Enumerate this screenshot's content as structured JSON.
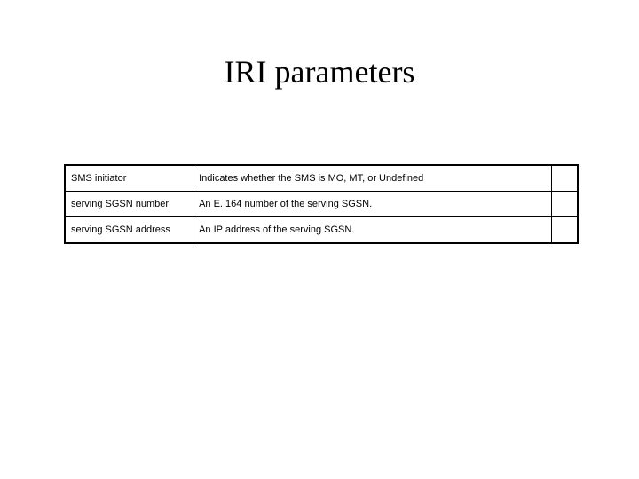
{
  "title": "IRI parameters",
  "table": {
    "rows": [
      {
        "param": "SMS initiator",
        "desc": "Indicates whether the SMS is MO, MT, or Undefined",
        "extra": ""
      },
      {
        "param": "serving SGSN number",
        "desc": "An E. 164 number of the serving SGSN.",
        "extra": ""
      },
      {
        "param": "serving SGSN address",
        "desc": "An IP address of the serving SGSN.",
        "extra": ""
      }
    ]
  }
}
